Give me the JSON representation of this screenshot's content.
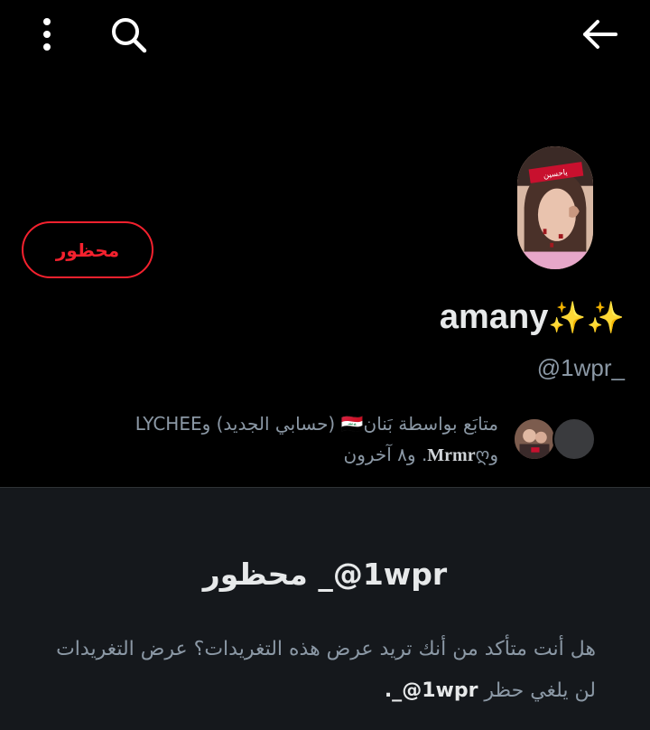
{
  "topbar": {
    "menu_icon": "more-vertical-icon",
    "search_icon": "search-icon",
    "back_icon": "arrow-left-icon"
  },
  "profile": {
    "display_name": "amany",
    "display_name_sparkles": "✨✨",
    "handle": "@1wpr_",
    "avatar_banner_text": "ياحسين",
    "blocked_label": "محظور",
    "accent_red": "#f4212e"
  },
  "followers": {
    "line1": "متابَع بواسطة بَنان🇮🇶 (حسابي الجديد) وLYCHEE",
    "line2_prefix": "و",
    "line2_name": "Mrmr",
    "line2_suffix": "ღ. و٨ آخرون"
  },
  "notice": {
    "title": "‎@1wpr_ محظور",
    "body": "هل أنت متأكد من أنك تريد عرض هذه التغريدات؟ عرض التغريدات لن يلغي حظر ",
    "body_handle": "‎@1wpr_.",
    "background": "#15181c"
  }
}
